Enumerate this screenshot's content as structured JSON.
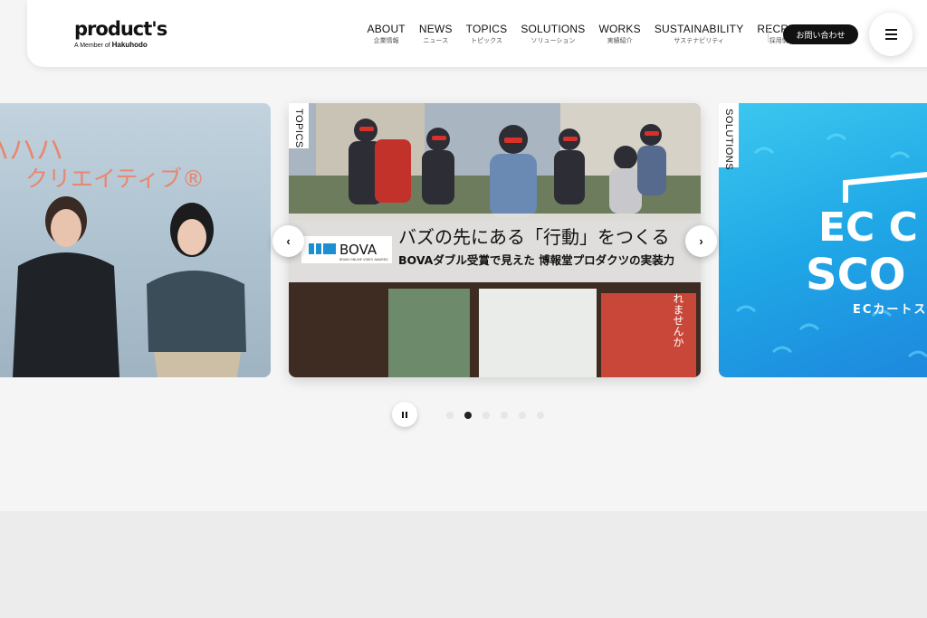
{
  "header": {
    "logo_text": "product's",
    "logo_sub_prefix": "A Member of",
    "logo_sub_brand": "Hakuhodo",
    "nav": [
      {
        "en": "ABOUT",
        "jp": "企業情報"
      },
      {
        "en": "NEWS",
        "jp": "ニュース"
      },
      {
        "en": "TOPICS",
        "jp": "トピックス"
      },
      {
        "en": "SOLUTIONS",
        "jp": "ソリューション"
      },
      {
        "en": "WORKS",
        "jp": "実績紹介"
      },
      {
        "en": "SUSTAINABILITY",
        "jp": "サステナビリティ"
      },
      {
        "en": "RECRUIT",
        "jp": "採用情報"
      }
    ],
    "contact_label": "お問い合わせ"
  },
  "carousel": {
    "left_slide": {
      "overlay_text_1": "ハハハ",
      "overlay_text_2": "クリエイティブ®"
    },
    "center_slide": {
      "category": "TOPICS",
      "badge": "BOVA",
      "badge_sub": "BRAIN ONLINE VIDEO AWARDS",
      "headline": "バズの先にある「行動」をつくる",
      "subheadline": "BOVAダブル受賞で見えた 博報堂プロダクツの実装力",
      "bg_text": "れませんか"
    },
    "right_slide": {
      "category": "SOLUTIONS",
      "big_text_1": "EC C",
      "big_text_2": "SCO",
      "small_text": "ECカートス"
    },
    "prev_label": "‹",
    "next_label": "›",
    "dot_count": 6,
    "active_dot": 1
  },
  "colors": {
    "accent": "#111111",
    "solutions_bg": "#1fa7e6"
  }
}
